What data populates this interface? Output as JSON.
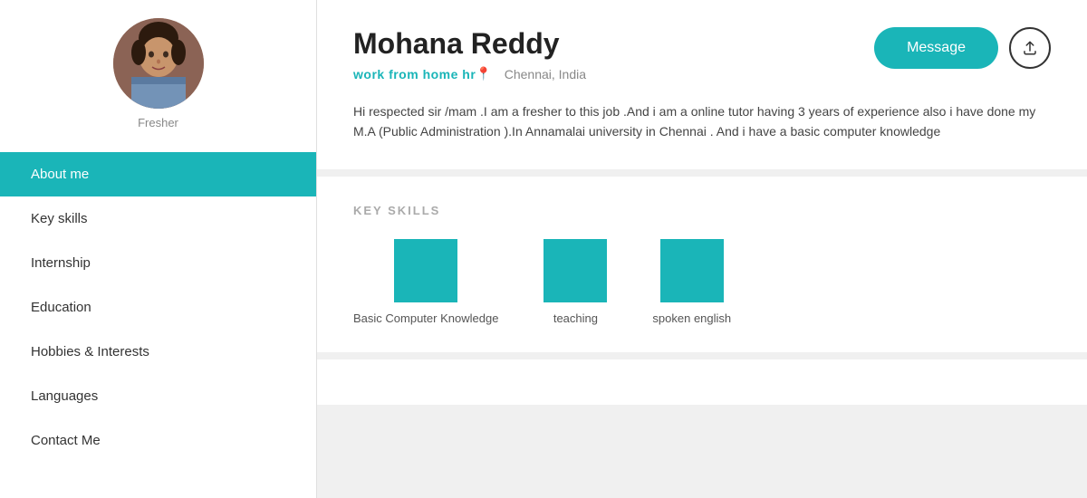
{
  "sidebar": {
    "fresher_label": "Fresher",
    "nav_items": [
      {
        "id": "about-me",
        "label": "About me",
        "active": true
      },
      {
        "id": "key-skills",
        "label": "Key skills",
        "active": false
      },
      {
        "id": "internship",
        "label": "Internship",
        "active": false
      },
      {
        "id": "education",
        "label": "Education",
        "active": false
      },
      {
        "id": "hobbies",
        "label": "Hobbies & Interests",
        "active": false
      },
      {
        "id": "languages",
        "label": "Languages",
        "active": false
      },
      {
        "id": "contact",
        "label": "Contact Me",
        "active": false
      }
    ]
  },
  "profile": {
    "name": "Mohana Reddy",
    "title": "work from home hr",
    "location": "Chennai, India",
    "bio": "Hi respected sir /mam .I am a fresher to this job .And i am a online tutor having 3 years of experience also i have done my M.A (Public Administration ).In Annamalai university in Chennai . And i have a basic computer knowledge",
    "message_btn_label": "Message"
  },
  "skills_section": {
    "title": "KEY SKILLS",
    "skills": [
      {
        "label": "Basic Computer Knowledge"
      },
      {
        "label": "teaching"
      },
      {
        "label": "spoken english"
      }
    ]
  },
  "icons": {
    "location": "📍",
    "share": "↑"
  }
}
